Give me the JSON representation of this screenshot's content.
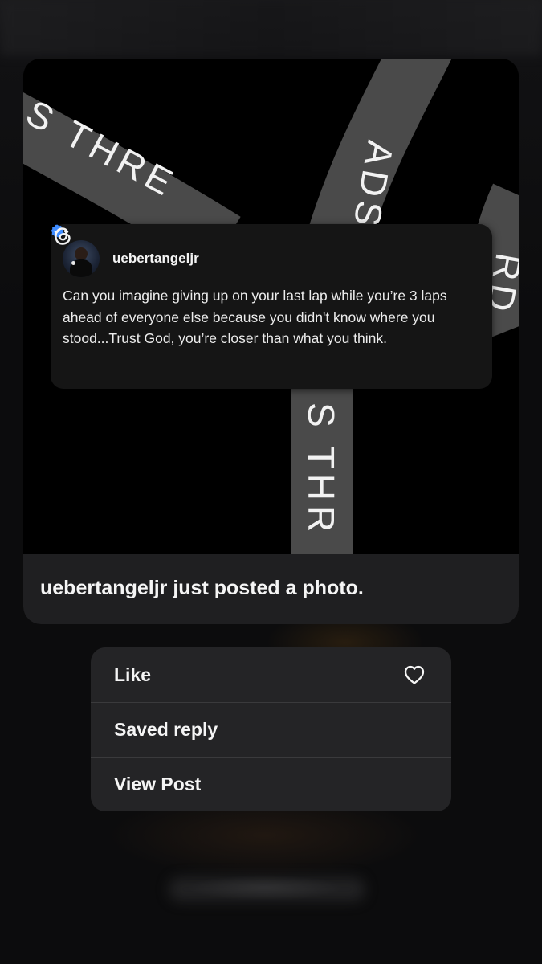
{
  "photo": {
    "band_texts": [
      "S THRE",
      "ADS TH",
      "RD",
      "S THR"
    ]
  },
  "post": {
    "username": "uebertangeljr",
    "verified": true,
    "text": "Can you imagine giving up on your last lap while you’re 3 laps ahead of everyone else because you didn't know where you stood...Trust God, you’re closer than what you think.",
    "logo_icon": "threads-icon"
  },
  "caption": "uebertangeljr just posted a photo.",
  "menu": {
    "items": [
      {
        "label": "Like",
        "icon": "heart-icon"
      },
      {
        "label": "Saved reply"
      },
      {
        "label": "View Post"
      }
    ]
  },
  "colors": {
    "verified_badge": "#3f8cff",
    "band": "#4a4a4a",
    "menu_bg": "#242426"
  }
}
